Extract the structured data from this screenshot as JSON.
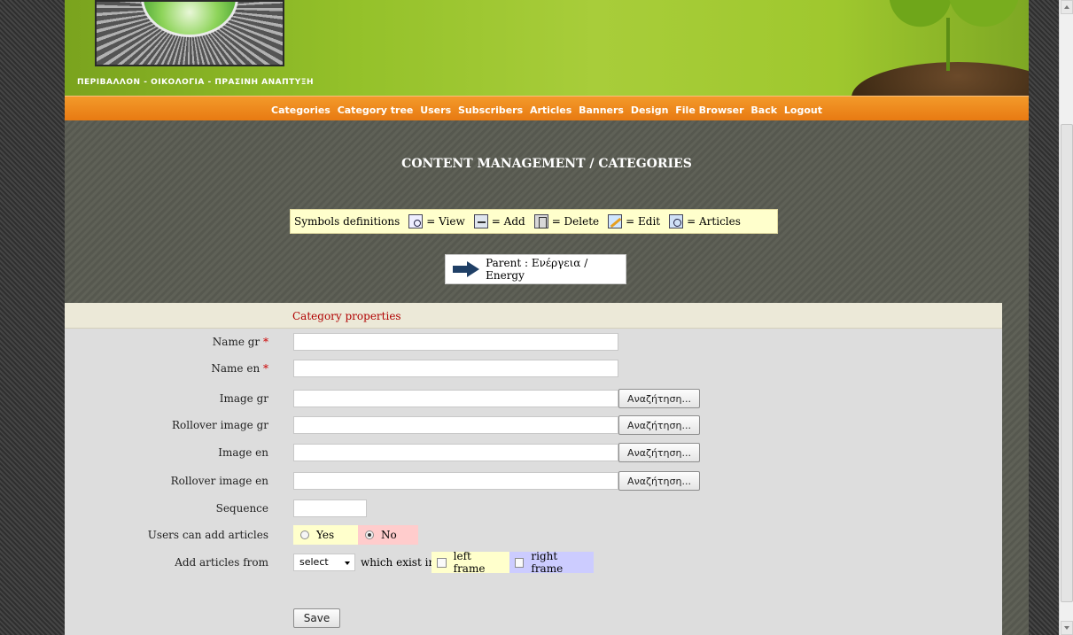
{
  "header": {
    "tagline": "ΠΕΡΙΒΑΛΛΟΝ - ΟΙΚΟΛΟΓΙΑ - ΠΡΑΣΙΝΗ ΑΝΑΠΤΥΞΗ"
  },
  "nav": {
    "items": [
      "Categories",
      "Category tree",
      "Users",
      "Subscribers",
      "Articles",
      "Banners",
      "Design",
      "File Browser",
      "Back",
      "Logout"
    ]
  },
  "page": {
    "title": "CONTENT MANAGEMENT / CATEGORIES"
  },
  "symbols": {
    "label": "Symbols definitions",
    "view": "= View",
    "add": "= Add",
    "delete": "= Delete",
    "edit": "= Edit",
    "articles": "= Articles"
  },
  "parent": {
    "text": "Parent : Ενέργεια / Energy"
  },
  "form": {
    "section_title": "Category properties",
    "name_gr_label": "Name gr",
    "name_en_label": "Name en",
    "required_mark": "*",
    "image_gr_label": "Image gr",
    "rollover_gr_label": "Rollover image gr",
    "image_en_label": "Image en",
    "rollover_en_label": "Rollover image en",
    "sequence_label": "Sequence",
    "users_add_label": "Users can add articles",
    "yes_label": "Yes",
    "no_label": "No",
    "selected_option": "No",
    "add_from_label": "Add articles from",
    "select_value": "select",
    "which_exist_label": "which exist in",
    "left_frame_label": "left frame",
    "right_frame_label": "right frame",
    "browse_label": "Αναζήτηση...",
    "save_label": "Save"
  }
}
